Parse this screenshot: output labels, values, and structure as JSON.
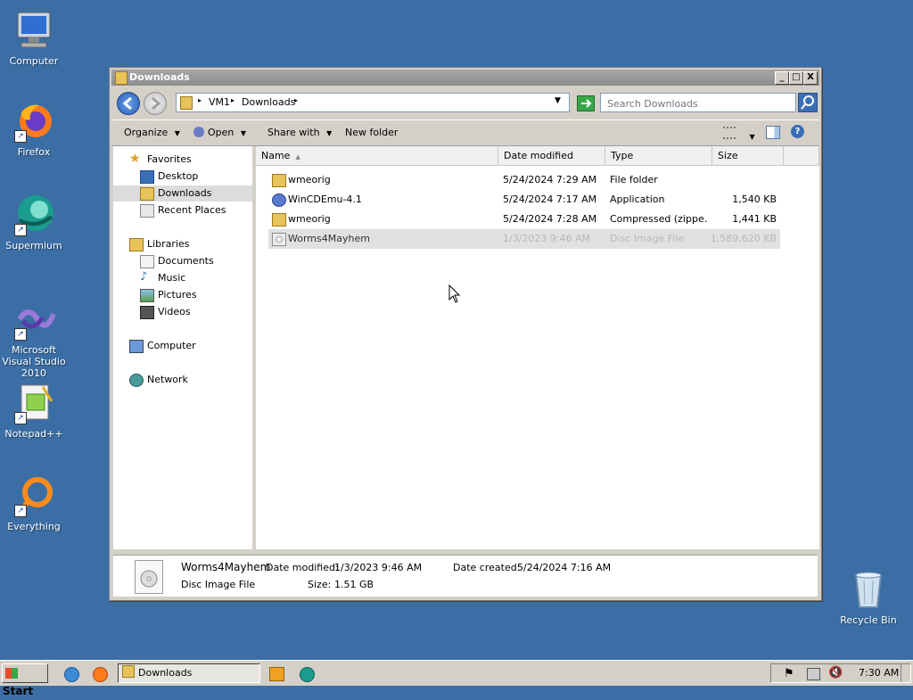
{
  "desktop": {
    "icons": [
      {
        "label": "Computer"
      },
      {
        "label": "Firefox"
      },
      {
        "label": "Supermium"
      },
      {
        "label": "Microsoft Visual Studio 2010"
      },
      {
        "label": "Notepad++"
      },
      {
        "label": "Everything"
      },
      {
        "label": "Recycle Bin"
      }
    ]
  },
  "window": {
    "title": "Downloads",
    "buttons": {
      "minimize": "_",
      "maximize": "□",
      "close": "X"
    },
    "address": {
      "crumbs": [
        "VM1",
        "Downloads"
      ]
    },
    "search": {
      "placeholder": "Search Downloads"
    },
    "toolbar": {
      "organize": "Organize",
      "open": "Open",
      "share_with": "Share with",
      "new_folder": "New folder"
    },
    "nav": {
      "favorites": "Favorites",
      "desktop": "Desktop",
      "downloads": "Downloads",
      "recent_places": "Recent Places",
      "libraries": "Libraries",
      "documents": "Documents",
      "music": "Music",
      "pictures": "Pictures",
      "videos": "Videos",
      "computer": "Computer",
      "network": "Network"
    },
    "columns": {
      "name": "Name",
      "date_modified": "Date modified",
      "type": "Type",
      "size": "Size"
    },
    "files": [
      {
        "name": "wmeorig",
        "date": "5/24/2024 7:29 AM",
        "type": "File folder",
        "size": ""
      },
      {
        "name": "WinCDEmu-4.1",
        "date": "5/24/2024 7:17 AM",
        "type": "Application",
        "size": "1,540 KB"
      },
      {
        "name": "wmeorig",
        "date": "5/24/2024 7:28 AM",
        "type": "Compressed (zippe…",
        "size": "1,441 KB"
      },
      {
        "name": "Worms4Mayhem",
        "date": "1/3/2023 9:46 AM",
        "type": "Disc Image File",
        "size": "1,589,620 KB"
      }
    ],
    "details": {
      "name": "Worms4Mayhem",
      "type": "Disc Image File",
      "date_modified_label": "Date modified:",
      "date_modified": "1/3/2023 9:46 AM",
      "date_created_label": "Date created:",
      "date_created": "5/24/2024 7:16 AM",
      "size_label": "Size:",
      "size": "1.51 GB"
    }
  },
  "taskbar": {
    "start": "Start",
    "task": "Downloads",
    "clock": "7:30 AM"
  },
  "colors": {
    "desktop": "#3b6ea5",
    "selection": "#e1e1e1",
    "title": "#999999"
  }
}
